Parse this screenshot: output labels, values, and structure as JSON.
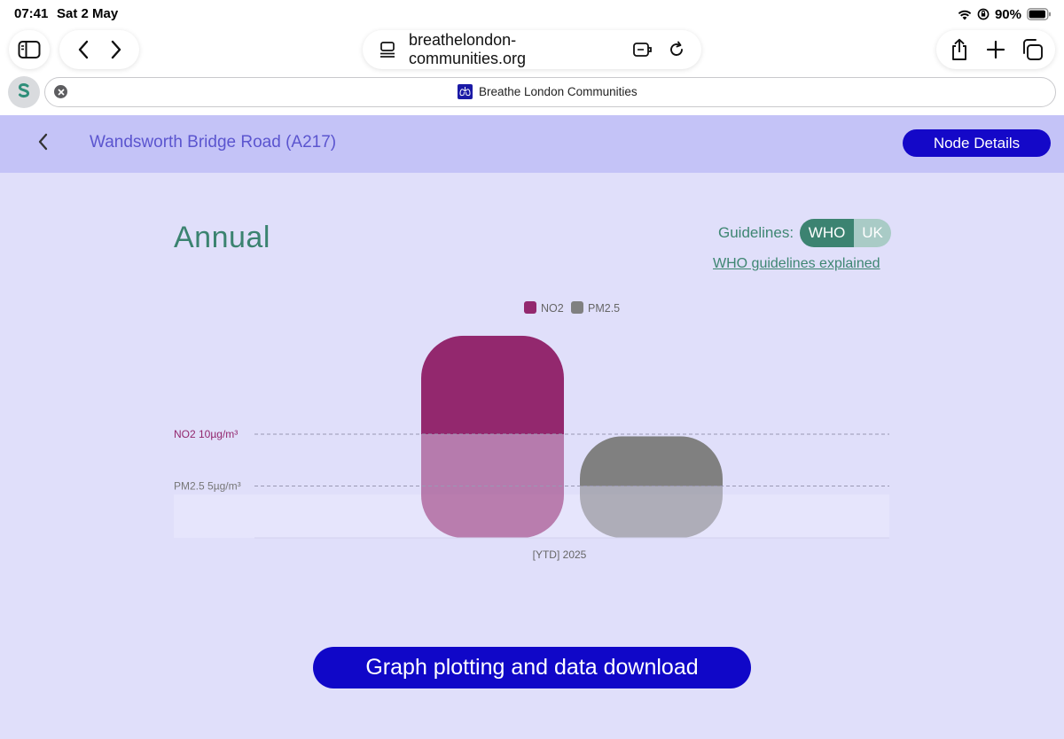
{
  "status_bar": {
    "time": "07:41",
    "date": "Sat 2 May",
    "battery": "90%"
  },
  "browser": {
    "url": "breathelondon-communities.org",
    "tab_title": "Breathe London Communities"
  },
  "header": {
    "site_name": "Wandsworth Bridge Road (A217)",
    "node_button": "Node Details"
  },
  "section": {
    "title": "Annual",
    "guidelines_label": "Guidelines:",
    "options": [
      "WHO",
      "UK"
    ],
    "selected": "WHO",
    "explain_link": "WHO guidelines explained"
  },
  "colors": {
    "accent": "#1408c8",
    "teal": "#3c8371",
    "no2": "#93286e",
    "pm25": "#808080"
  },
  "chart_data": {
    "type": "bar",
    "categories": [
      "[YTD] 2025"
    ],
    "series": [
      {
        "name": "NO2",
        "values": [
          19.5
        ],
        "color": "#93286e"
      },
      {
        "name": "PM2.5",
        "values": [
          9.8
        ],
        "color": "#808080"
      }
    ],
    "guidelines": [
      {
        "label": "NO2 10µg/m³",
        "value": 10,
        "color": "#93286e"
      },
      {
        "label": "PM2.5 5µg/m³",
        "value": 5,
        "color": "#777777"
      }
    ],
    "ylim": [
      0,
      20
    ],
    "xlabel": "",
    "ylabel": "",
    "legend": "top-center"
  },
  "cta_button": "Graph plotting and data download"
}
